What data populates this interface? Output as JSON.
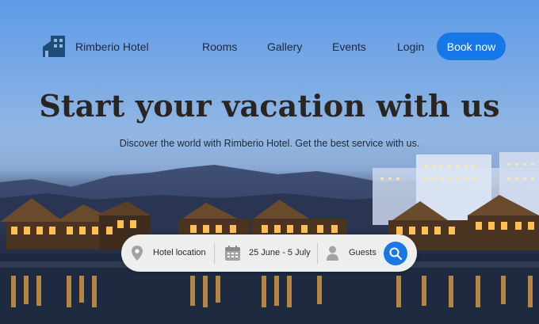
{
  "brand": {
    "name": "Rimberio Hotel"
  },
  "nav": {
    "rooms": "Rooms",
    "gallery": "Gallery",
    "events": "Events",
    "login": "Login",
    "book": "Book now"
  },
  "hero": {
    "title": "Start your vacation with us",
    "subtitle": "Discover the world with Rimberio Hotel. Get the best service with us."
  },
  "search": {
    "location": "Hotel location",
    "dates": "25 June - 5 July",
    "guests": "Guests"
  },
  "colors": {
    "accent": "#1877e8",
    "text": "#1d2a3c"
  },
  "icons": {
    "logo": "hotel-building-icon",
    "location": "map-pin-icon",
    "calendar": "calendar-icon",
    "guests": "user-icon",
    "search": "search-icon"
  }
}
